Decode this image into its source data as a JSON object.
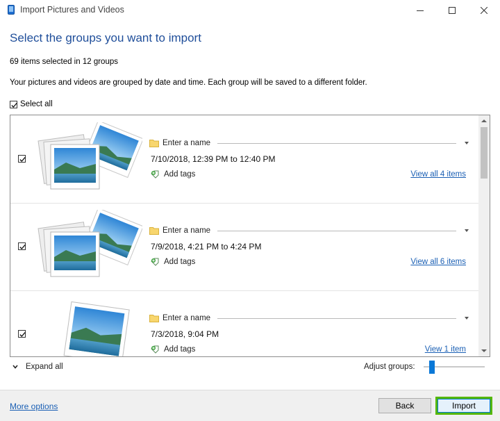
{
  "window": {
    "title": "Import Pictures and Videos",
    "controls": [
      "minimize",
      "maximize",
      "close"
    ]
  },
  "heading": "Select the groups you want to import",
  "summary": "69 items selected in 12 groups",
  "description": "Your pictures and videos are grouped by date and time. Each group will be saved to a different folder.",
  "select_all": {
    "label": "Select all",
    "checked": true
  },
  "groups": [
    {
      "checked": true,
      "name_placeholder": "Enter a name",
      "date": "7/10/2018, 12:39 PM to 12:40 PM",
      "tags_label": "Add tags",
      "view_link": "View all 4 items",
      "thumbnail_count": 4
    },
    {
      "checked": true,
      "name_placeholder": "Enter a name",
      "date": "7/9/2018, 4:21 PM to 4:24 PM",
      "tags_label": "Add tags",
      "view_link": "View all 6 items",
      "thumbnail_count": 4
    },
    {
      "checked": true,
      "name_placeholder": "Enter a name",
      "date": "7/3/2018, 9:04 PM",
      "tags_label": "Add tags",
      "view_link": "View 1 item",
      "thumbnail_count": 1
    }
  ],
  "expand_all": "Expand all",
  "adjust_groups": {
    "label": "Adjust groups:",
    "level": 0.1
  },
  "footer": {
    "more_options": "More options",
    "back": "Back",
    "import": "Import"
  },
  "colors": {
    "heading": "#1f4e9a",
    "link": "#1a5fb4",
    "import_highlight": "#55b700",
    "slider_thumb": "#0a78d7"
  }
}
